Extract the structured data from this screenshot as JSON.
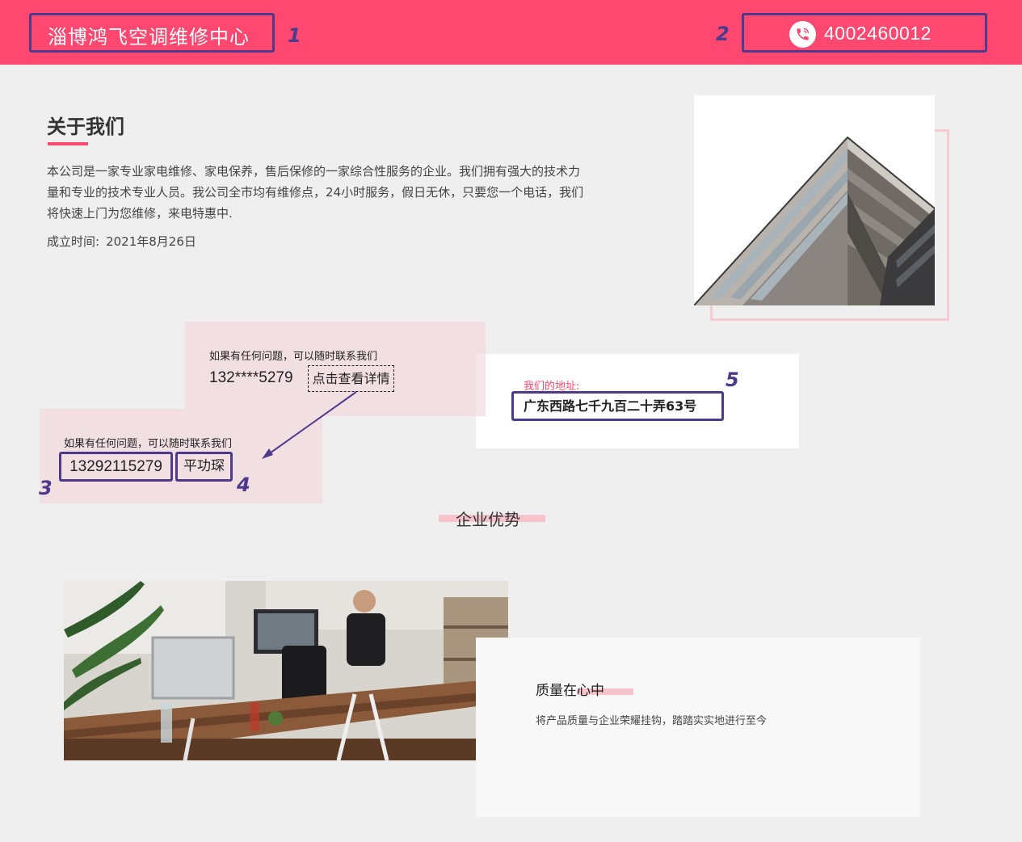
{
  "header": {
    "site_title": "淄博鸿飞空调维修中心",
    "phone": "4002460012",
    "phone_icon": "phone-icon",
    "bg_color": "#fe4870"
  },
  "annotations": {
    "m1": "1",
    "m2": "2",
    "m3": "3",
    "m4": "4",
    "m5": "5",
    "color": "#4e3a8b"
  },
  "about": {
    "heading": "关于我们",
    "paragraph": "本公司是一家专业家电维修、家电保养，售后保修的一家综合性服务的企业。我们拥有强大的技术力量和专业的技术专业人员。我公司全市均有维修点，24小时服务，假日无休，只要您一个电话，我们将快速上门为您维修，来电特惠中.",
    "founded_label": "成立时间:",
    "founded_date": "2021年8月26日"
  },
  "contact_card_1": {
    "hint": "如果有任何问题，可以随时联系我们",
    "masked_phone": "132****5279",
    "detail_button": "点击查看详情"
  },
  "contact_card_2": {
    "hint": "如果有任何问题，可以随时联系我们",
    "full_phone": "13292115279",
    "name": "平功琛"
  },
  "address": {
    "label": "我们的地址:",
    "value": "广东西路七千九百二十弄63号"
  },
  "advantages": {
    "title": "企业优势",
    "item_title": "质量在心中",
    "item_text": "将产品质量与企业荣耀挂钩，踏踏实实地进行至今"
  }
}
